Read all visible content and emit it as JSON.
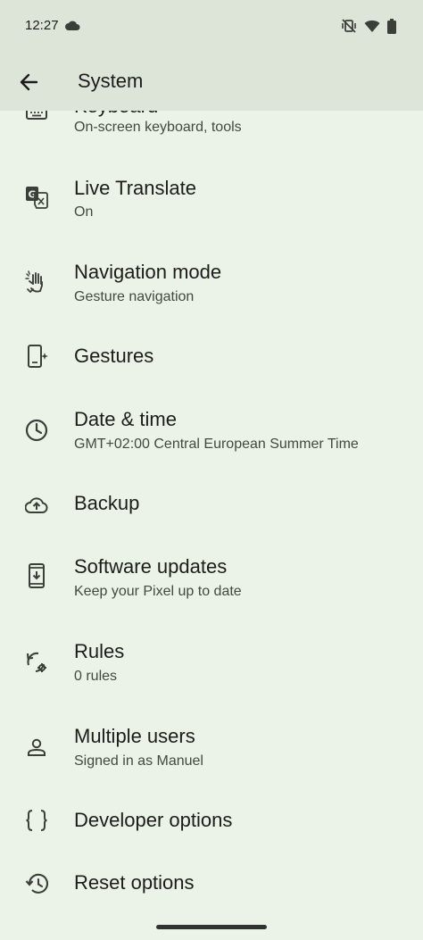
{
  "status_bar": {
    "time": "12:27",
    "icons": [
      "cloud-icon",
      "vibrate-mute-icon",
      "wifi-icon",
      "battery-icon"
    ]
  },
  "app_bar": {
    "title": "System",
    "back_icon": "arrow-back-icon"
  },
  "settings": [
    {
      "id": "keyboard",
      "label": "Keyboard",
      "sub": "On-screen keyboard, tools",
      "icon": "keyboard-icon"
    },
    {
      "id": "live-translate",
      "label": "Live Translate",
      "sub": "On",
      "icon": "translate-icon"
    },
    {
      "id": "navigation-mode",
      "label": "Navigation mode",
      "sub": "Gesture navigation",
      "icon": "gesture-hand-icon"
    },
    {
      "id": "gestures",
      "label": "Gestures",
      "sub": "",
      "icon": "phone-sparkle-icon"
    },
    {
      "id": "date-time",
      "label": "Date & time",
      "sub": "GMT+02:00 Central European Summer Time",
      "icon": "clock-icon"
    },
    {
      "id": "backup",
      "label": "Backup",
      "sub": "",
      "icon": "cloud-upload-icon"
    },
    {
      "id": "software-updates",
      "label": "Software updates",
      "sub": "Keep your Pixel up to date",
      "icon": "system-update-icon"
    },
    {
      "id": "rules",
      "label": "Rules",
      "sub": "0 rules",
      "icon": "rules-icon"
    },
    {
      "id": "multiple-users",
      "label": "Multiple users",
      "sub": "Signed in as Manuel",
      "icon": "person-icon"
    },
    {
      "id": "developer-options",
      "label": "Developer options",
      "sub": "",
      "icon": "braces-icon"
    },
    {
      "id": "reset-options",
      "label": "Reset options",
      "sub": "",
      "icon": "history-icon"
    }
  ],
  "colors": {
    "background": "#ebf2e7",
    "app_bar": "#dde5d9",
    "text_primary": "#1b1d1a",
    "text_secondary": "#42493f"
  }
}
